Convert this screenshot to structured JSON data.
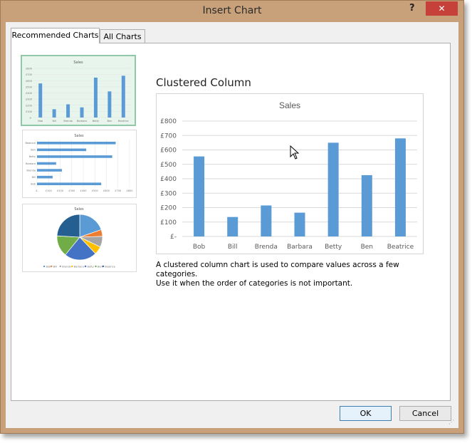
{
  "window": {
    "title": "Insert Chart",
    "help_label": "?",
    "close_label": "✕"
  },
  "tabs": [
    {
      "label": "Recommended Charts",
      "active": true
    },
    {
      "label": "All Charts",
      "active": false
    }
  ],
  "thumbnails": [
    {
      "type": "column",
      "title": "Sales",
      "selected": true
    },
    {
      "type": "bar",
      "title": "Sales",
      "selected": false
    },
    {
      "type": "pie",
      "title": "Sales",
      "selected": false
    }
  ],
  "thumb_legend": [
    "Bob",
    "Bill",
    "Brenda",
    "Barbara",
    "Betty",
    "Ben",
    "Beatrice"
  ],
  "preview": {
    "heading": "Clustered Column",
    "description_line1": "A clustered column chart is used to compare values across a few categories.",
    "description_line2": "Use it when the order of categories is not important."
  },
  "chart_data": {
    "type": "bar",
    "title": "Sales",
    "categories": [
      "Bob",
      "Bill",
      "Brenda",
      "Barbara",
      "Betty",
      "Ben",
      "Beatrice"
    ],
    "values": [
      555,
      135,
      215,
      165,
      650,
      425,
      680
    ],
    "yticks": [
      "£-",
      "£100",
      "£200",
      "£300",
      "£400",
      "£500",
      "£600",
      "£700",
      "£800"
    ],
    "ylim": [
      0,
      800
    ],
    "grid": true,
    "color": "#5b9bd5"
  },
  "pie_colors": [
    "#5b9bd5",
    "#ed7d31",
    "#a5a5a5",
    "#ffc000",
    "#4472c4",
    "#70ad47",
    "#255e91"
  ],
  "buttons": {
    "ok": "OK",
    "cancel": "Cancel"
  }
}
